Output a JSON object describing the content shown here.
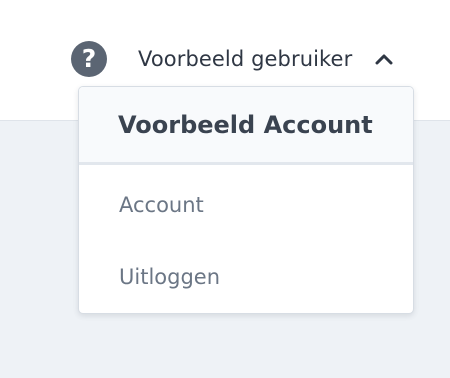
{
  "header": {
    "help_icon_glyph": "?",
    "user_name": "Voorbeeld gebruiker",
    "chevron_icon": "chevron-up-icon"
  },
  "dropdown": {
    "title": "Voorbeeld Account",
    "items": [
      {
        "label": "Account"
      },
      {
        "label": "Uitloggen"
      }
    ]
  },
  "colors": {
    "page_background": "#eef2f6",
    "header_background": "#ffffff",
    "icon": "#5b6573",
    "text_dark": "#2f3744",
    "menu_text": "#6b7685"
  }
}
